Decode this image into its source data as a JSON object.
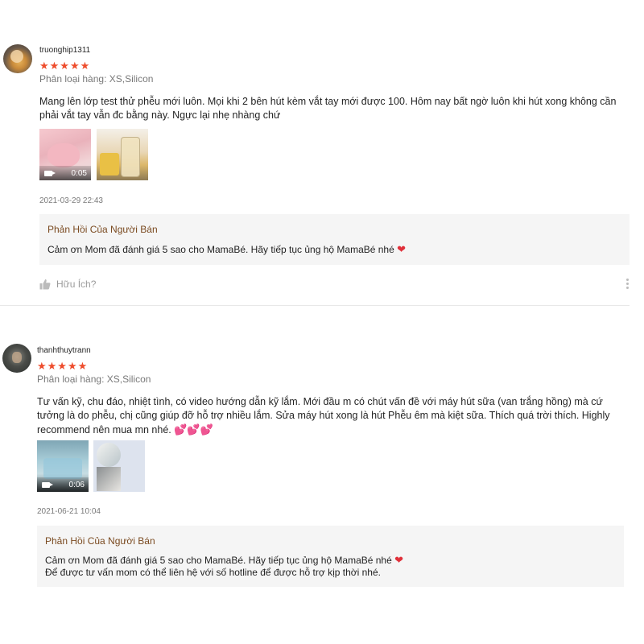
{
  "reviews": [
    {
      "username": "truonghip1311",
      "stars": "★★★★★",
      "variation": "Phân loại hàng: XS,Silicon",
      "comment": "Mang lên lớp test thử phễu mới luôn. Mọi khi 2 bên hút kèm vắt tay mới được 100. Hôm nay bất ngờ luôn khi hút xong không cần phải vắt tay vẫn đc bằng này. Ngực lại nhẹ nhàng chứ",
      "media": [
        {
          "type": "video",
          "duration": "0:05"
        },
        {
          "type": "image"
        }
      ],
      "date": "2021-03-29 22:43",
      "seller_reply": {
        "title": "Phản Hồi Của Người Bán",
        "text": "Cảm ơn Mom đã đánh giá 5 sao cho MamaBé. Hãy tiếp tục ủng hộ MamaBé nhé",
        "heart": "❤"
      },
      "helpful_label": "Hữu Ích?"
    },
    {
      "username": "thanhthuytrann",
      "stars": "★★★★★",
      "variation": "Phân loại hàng: XS,Silicon",
      "comment": "Tư vấn kỹ, chu đáo, nhiệt tình, có video hướng dẫn kỹ lắm. Mới đầu m có chút vấn đề với máy hút sữa (van trắng hồng) mà cứ tưởng là do phễu, chị cũng giúp đỡ hỗ trợ nhiều lắm. Sửa máy hút xong là hút Phễu êm mà kiệt sữa. Thích quá trời thích. Highly recommend nên mua mn nhé.",
      "comment_hearts": "💕💕💕",
      "media": [
        {
          "type": "video",
          "duration": "0:06"
        },
        {
          "type": "image"
        }
      ],
      "date": "2021-06-21 10:04",
      "seller_reply": {
        "title": "Phản Hồi Của Người Bán",
        "line1": "Cảm ơn Mom đã đánh giá 5 sao cho MamaBé. Hãy tiếp tục ủng hộ MamaBé nhé",
        "heart": "❤",
        "line2": "Để được tư vấn mom có thể liên hệ với số hotline để được hỗ trợ kịp thời nhé."
      }
    }
  ],
  "icons": {
    "star": "star-icon",
    "thumbs_up": "thumbs-up-icon",
    "more": "more-vertical-icon",
    "video": "video-camera-icon"
  },
  "colors": {
    "star": "#ee4d2d",
    "seller_title": "#7a4a20",
    "seller_bg": "#f5f5f5",
    "heart": "#e0303a"
  }
}
